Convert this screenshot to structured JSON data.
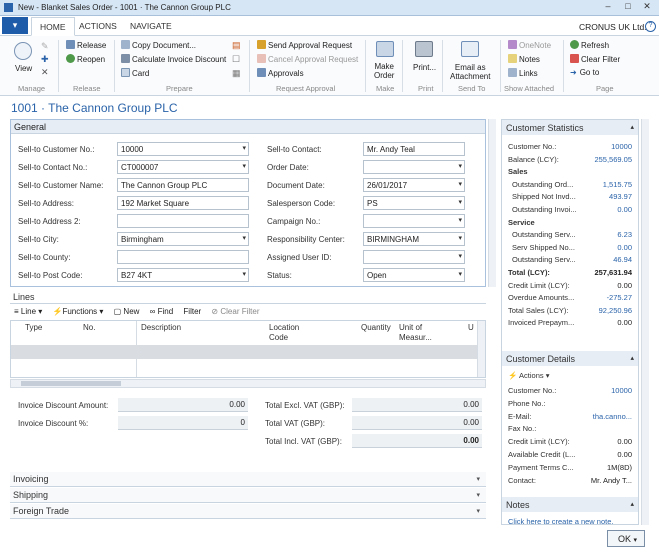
{
  "window": {
    "title": "New - Blanket Sales Order - 1001 · The Cannon Group PLC",
    "minimize": "–",
    "restore": "□",
    "close": "✕"
  },
  "ribbon": {
    "tabs": [
      "HOME",
      "ACTIONS",
      "NAVIGATE"
    ],
    "company": "CRONUS UK Ltd.",
    "help": "?",
    "groups": [
      "Manage",
      "Release",
      "Prepare",
      "Request Approval",
      "Make",
      "Print",
      "Send To",
      "Show Attached",
      "Page"
    ],
    "buttons": {
      "view": "View",
      "release": "Release",
      "reopen": "Reopen",
      "copy_document": "Copy Document...",
      "calc_discount": "Calculate Invoice Discount",
      "card": "Card",
      "send_approval": "Send Approval Request",
      "cancel_approval": "Cancel Approval Request",
      "approvals": "Approvals",
      "make_order_1": "Make",
      "make_order_2": "Order",
      "print": "Print...",
      "email_1": "Email as",
      "email_2": "Attachment",
      "onenote": "OneNote",
      "notes": "Notes",
      "links": "Links",
      "refresh": "Refresh",
      "clear_filter": "Clear Filter",
      "go_to": "Go to"
    }
  },
  "page_title": "1001 · The Cannon Group PLC",
  "general": {
    "title": "General",
    "left": [
      {
        "label": "Sell-to Customer No.:",
        "value": "10000",
        "dd": true
      },
      {
        "label": "Sell-to Contact No.:",
        "value": "CT000007",
        "dd": true
      },
      {
        "label": "Sell-to Customer Name:",
        "value": "The Cannon Group PLC",
        "dd": false
      },
      {
        "label": "Sell-to Address:",
        "value": "192 Market Square",
        "dd": false
      },
      {
        "label": "Sell-to Address 2:",
        "value": "",
        "dd": false
      },
      {
        "label": "Sell-to City:",
        "value": "Birmingham",
        "dd": true
      },
      {
        "label": "Sell-to County:",
        "value": "",
        "dd": false
      },
      {
        "label": "Sell-to Post Code:",
        "value": "B27 4KT",
        "dd": true
      }
    ],
    "right": [
      {
        "label": "Sell-to Contact:",
        "value": "Mr. Andy Teal",
        "dd": false
      },
      {
        "label": "Order Date:",
        "value": "",
        "dd": true
      },
      {
        "label": "Document Date:",
        "value": "26/01/2017",
        "dd": true
      },
      {
        "label": "Salesperson Code:",
        "value": "PS",
        "dd": true
      },
      {
        "label": "Campaign No.:",
        "value": "",
        "dd": true
      },
      {
        "label": "Responsibility Center:",
        "value": "BIRMINGHAM",
        "dd": true
      },
      {
        "label": "Assigned User ID:",
        "value": "",
        "dd": true
      },
      {
        "label": "Status:",
        "value": "Open",
        "dd": true
      }
    ]
  },
  "lines": {
    "title": "Lines",
    "toolbar": [
      "Line",
      "Functions",
      "New",
      "Find",
      "Filter",
      "Clear Filter"
    ],
    "columns": [
      "Type",
      "No.",
      "Description",
      "Location Code",
      "Quantity",
      "Unit of Measur...",
      "U"
    ],
    "totals_left": [
      {
        "label": "Invoice Discount Amount:",
        "value": "0.00"
      },
      {
        "label": "Invoice Discount %:",
        "value": "0"
      }
    ],
    "totals_right": [
      {
        "label": "Total Excl. VAT (GBP):",
        "value": "0.00"
      },
      {
        "label": "Total VAT (GBP):",
        "value": "0.00"
      },
      {
        "label": "Total Incl. VAT (GBP):",
        "value": "0.00"
      }
    ]
  },
  "fasttabs": [
    "Invoicing",
    "Shipping",
    "Foreign Trade"
  ],
  "factbox": {
    "stats_title": "Customer Statistics",
    "stats": [
      {
        "label": "Customer No.:",
        "value": "10000"
      },
      {
        "label": "Balance (LCY):",
        "value": "255,569.05"
      }
    ],
    "sales_heading": "Sales",
    "sales": [
      {
        "label": "Outstanding Ord...",
        "value": "1,515.75"
      },
      {
        "label": "Shipped Not Invd...",
        "value": "493.97"
      },
      {
        "label": "Outstanding Invoi...",
        "value": "0.00"
      }
    ],
    "service_heading": "Service",
    "service": [
      {
        "label": "Outstanding Serv...",
        "value": "6.23"
      },
      {
        "label": "Serv Shipped No...",
        "value": "0.00"
      },
      {
        "label": "Outstanding Serv...",
        "value": "46.94"
      }
    ],
    "totals": [
      {
        "label": "Total (LCY):",
        "value": "257,631.94"
      },
      {
        "label": "Credit Limit (LCY):",
        "value": "0.00"
      },
      {
        "label": "Overdue Amounts...",
        "value": "-275.27"
      },
      {
        "label": "Total Sales (LCY):",
        "value": "92,250.96"
      },
      {
        "label": "Invoiced Prepaym...",
        "value": "0.00"
      }
    ],
    "details_title": "Customer Details",
    "details_actions": "Actions",
    "details": [
      {
        "label": "Customer No.:",
        "value": "10000"
      },
      {
        "label": "Phone No.:",
        "value": ""
      },
      {
        "label": "E-Mail:",
        "value": "tha.canno..."
      },
      {
        "label": "Fax No.:",
        "value": ""
      },
      {
        "label": "Credit Limit (LCY):",
        "value": "0.00"
      },
      {
        "label": "Available Credit (L...",
        "value": "0.00"
      },
      {
        "label": "Payment Terms C...",
        "value": "1M(8D)"
      },
      {
        "label": "Contact:",
        "value": "Mr. Andy T..."
      }
    ],
    "notes_title": "Notes",
    "notes_link": "Click here to create a new note."
  },
  "ok_label": "OK"
}
